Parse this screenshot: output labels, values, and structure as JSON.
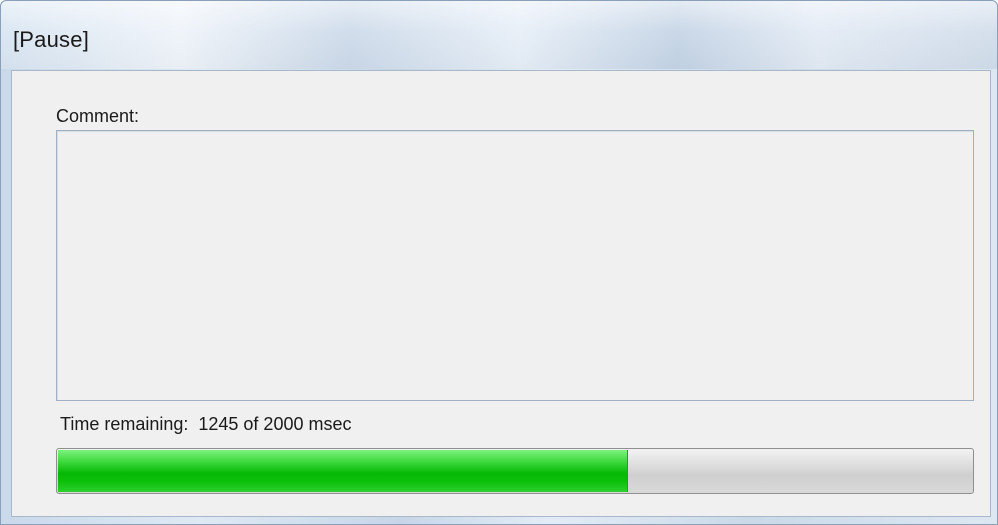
{
  "window": {
    "title": "[Pause]"
  },
  "comment": {
    "label": "Comment:",
    "value": ""
  },
  "timer": {
    "label": "Time remaining:  1245 of 2000 msec",
    "remaining_msec": 1245,
    "total_msec": 2000,
    "progress_fraction": 0.6225
  },
  "colors": {
    "progress_fill": "#06b906",
    "progress_track": "#d4d4d4"
  }
}
